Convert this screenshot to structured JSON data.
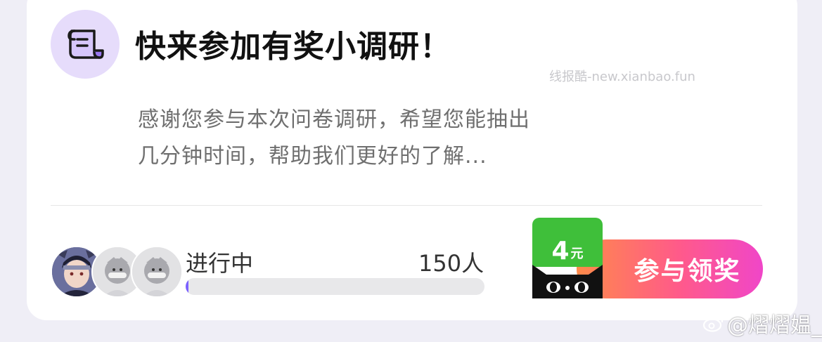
{
  "survey_card": {
    "title": "快来参加有奖小调研！",
    "description": "感谢您参与本次问卷调研，希望您能抽出几分钟时间，帮助我们更好的了解...",
    "status": "进行中",
    "participant_count": "150人",
    "progress_fraction": 0.01,
    "icon": "scroll-icon",
    "avatars": [
      "ninja-avatar",
      "default-avatar",
      "default-avatar"
    ]
  },
  "reward": {
    "amount": "4",
    "unit": "元",
    "icon": "tmall-cat-icon"
  },
  "cta": {
    "label": "参与领奖"
  },
  "watermarks": {
    "top": "线报酷-new.xianbao.fun",
    "footer": "@熠熠媪_"
  },
  "colors": {
    "icon_bg": "#e6dcfb",
    "icon_purple": "#7b4fd6",
    "cta_start": "#ff8a4a",
    "cta_end": "#f046c8",
    "reward_green": "#3fbf3a",
    "progress_fill": "#7b61ff"
  }
}
